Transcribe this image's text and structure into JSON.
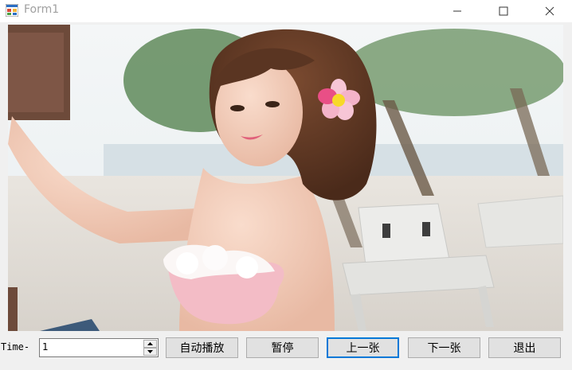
{
  "window": {
    "title": "Form1",
    "app_icon": "form-app-icon",
    "controls": [
      "minimize-icon",
      "maximize-icon",
      "close-icon"
    ]
  },
  "picture": {
    "icon": "photo-image"
  },
  "timer": {
    "label": "Time-",
    "value": "1"
  },
  "buttons": {
    "auto_play": "自动播放",
    "pause": "暂停",
    "prev": "上一张",
    "next": "下一张",
    "exit": "退出"
  },
  "colors": {
    "focus_border": "#0078d7",
    "button_bg": "#e1e1e1",
    "form_bg": "#f0f0f0"
  }
}
